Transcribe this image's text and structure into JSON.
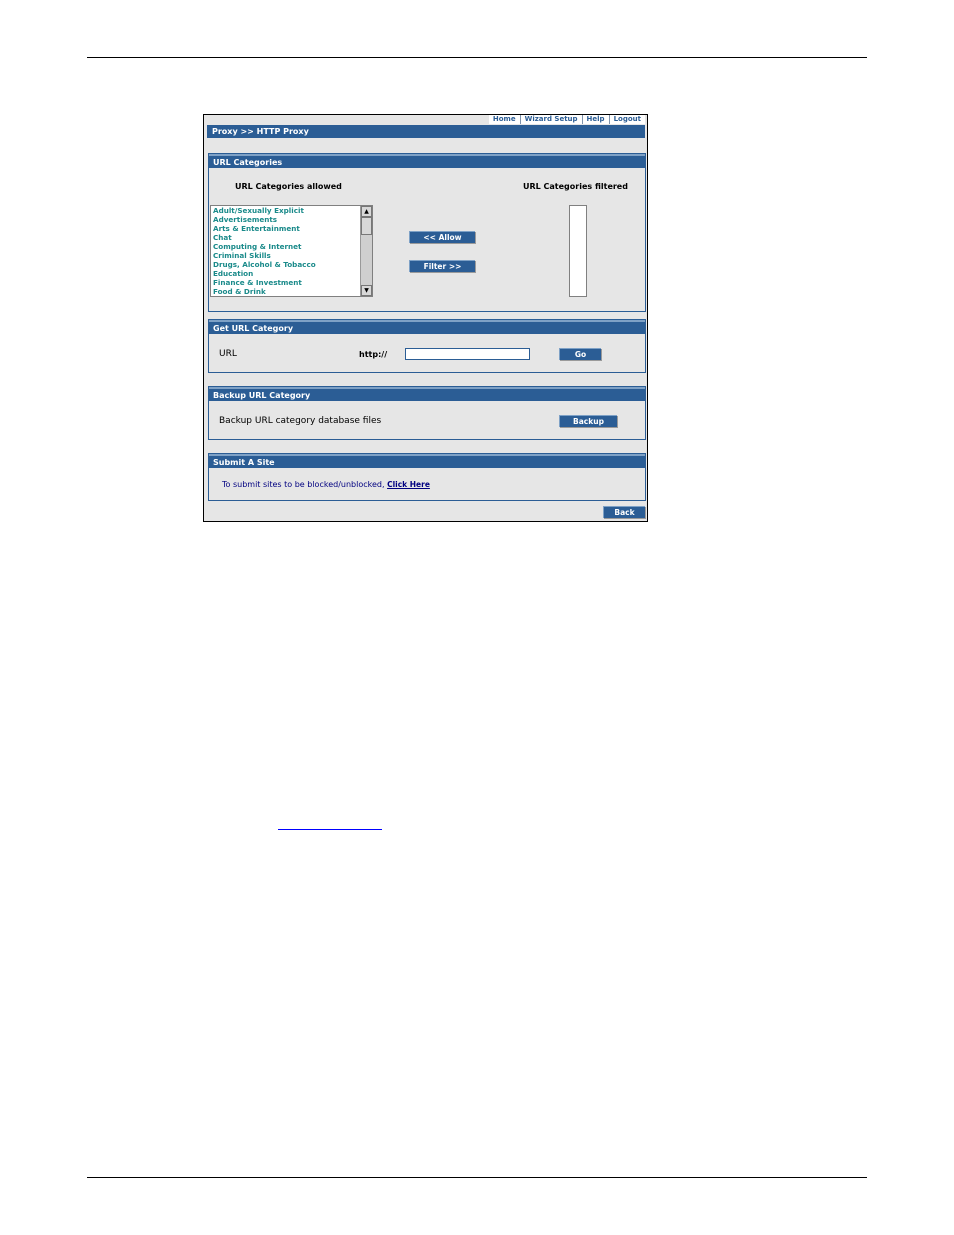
{
  "nav": {
    "home": "Home",
    "wizard": "Wizard Setup",
    "help": "Help",
    "logout": "Logout"
  },
  "breadcrumb": "Proxy >> HTTP Proxy",
  "url_categories": {
    "title": "URL Categories",
    "allowed_label": "URL Categories allowed",
    "filtered_label": "URL Categories filtered",
    "allowed_items": [
      "Adult/Sexually Explicit",
      "Advertisements",
      "Arts & Entertainment",
      "Chat",
      "Computing & Internet",
      "Criminal Skills",
      "Drugs, Alcohol & Tobacco",
      "Education",
      "Finance & Investment",
      "Food & Drink"
    ],
    "allow_button": "<< Allow",
    "filter_button": "Filter >>"
  },
  "get_url": {
    "title": "Get URL Category",
    "label": "URL",
    "prefix": "http://",
    "value": "",
    "go_button": "Go"
  },
  "backup": {
    "title": "Backup URL Category",
    "description": "Backup URL category database files",
    "button": "Backup"
  },
  "submit": {
    "title": "Submit A Site",
    "text": "To submit sites to be blocked/unblocked,",
    "link": "Click Here"
  },
  "back_button": "Back",
  "colors": {
    "header_blue": "#2b5d95",
    "panel_gray": "#e6e6e6",
    "list_teal": "#1a8a8a"
  }
}
